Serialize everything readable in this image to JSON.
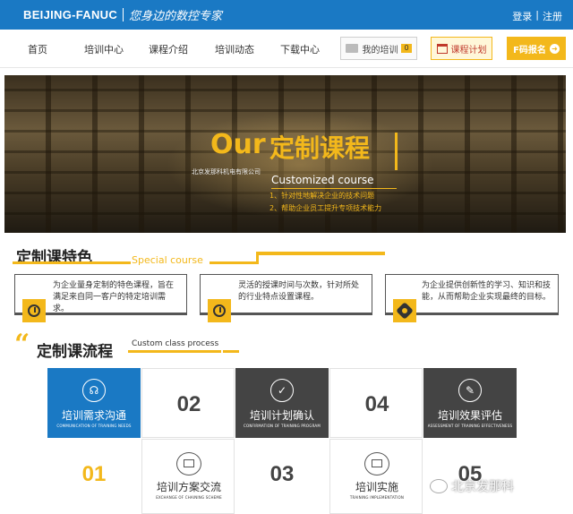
{
  "header": {
    "logo_brand": "BEIJING-FANUC",
    "logo_slogan": "您身边的数控专家",
    "login": "登录",
    "divider": "|",
    "register": "注册"
  },
  "nav": {
    "items": [
      "首页",
      "培训中心",
      "课程介绍",
      "培训动态",
      "下载中心"
    ],
    "my_training": "我的培训",
    "my_training_count": "0",
    "training_plan": "课程计划",
    "signup": "F码报名"
  },
  "banner": {
    "our": "Our",
    "title": "定制课程",
    "company": "北京发那科机电有限公司",
    "subtitle": "Customized course",
    "point1": "1、针对性地解决企业的技术问题",
    "point2": "2、帮助企业员工提升专项技术能力"
  },
  "features": {
    "title": "定制课特色",
    "title_en": "Special course",
    "items": [
      {
        "text": "为企业量身定制的特色课程，旨在满足来自同一客户的特定培训需求。",
        "icon": "target-icon"
      },
      {
        "text": "灵活的授课时间与次数，针对所处的行业特点设置课程。",
        "icon": "clock-icon"
      },
      {
        "text": "为企业提供创新性的学习、知识和技能，从而帮助企业实现最终的目标。",
        "icon": "gear-icon"
      }
    ]
  },
  "process": {
    "quote": "“",
    "title": "定制课流程",
    "title_en": "Custom class process",
    "steps": [
      {
        "label": "培训需求沟通",
        "sub": "COMMUNICATION OF TRAINING NEEDS",
        "icon": "headset-icon"
      },
      {
        "num": "02"
      },
      {
        "label": "培训计划确认",
        "sub": "CONFIRMATION OF TRAINING PROGRAM",
        "icon": "check-icon"
      },
      {
        "num": "04"
      },
      {
        "label": "培训效果评估",
        "sub": "ASSESSMENT OF TRAINING EFFECTIVENESS",
        "icon": "edit-icon"
      },
      {
        "num": "01"
      },
      {
        "label": "培训方案交流",
        "sub": "EXCHANGE OF CHAINING SCHEME",
        "icon": "chat-icon"
      },
      {
        "num": "03"
      },
      {
        "label": "培训实施",
        "sub": "TRAINING IMPLEMENTATION",
        "icon": "monitor-icon"
      },
      {
        "num": "05"
      }
    ]
  },
  "watermark": "北京发那科",
  "colors": {
    "brand_blue": "#1a79c4",
    "accent_yellow": "#f3b81b",
    "dark": "#444444"
  }
}
